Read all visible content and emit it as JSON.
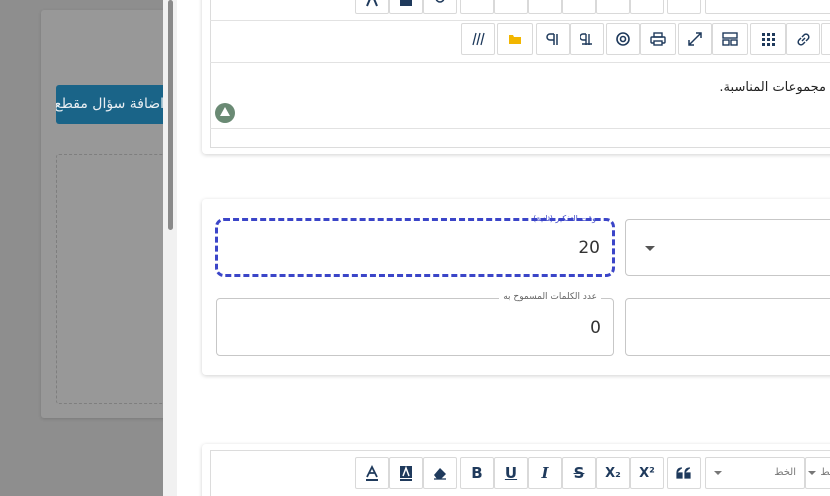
{
  "background": {
    "button_label": "اضافة سؤال مقطع"
  },
  "editor_top": {
    "content_text": "مجموعات المناسبة.",
    "toolbar_row2_icons": [
      "show-blocks-icon",
      "folder-icon",
      "paragraph-rtl-icon",
      "paragraph-ltr-icon",
      "mention-icon",
      "print-icon",
      "fullscreen-icon",
      "template-icon",
      "table-icon",
      "unlink-icon"
    ]
  },
  "form": {
    "time_label": "وقت التفكير (ثانية)",
    "time_value": "20",
    "words_label": "عدد الكلمات المسموح به",
    "words_value": "0"
  },
  "editor_bottom": {
    "font_select_label": "الخط",
    "size_select_label": "خط",
    "superscript_label": "X²",
    "subscript_label": "X₂",
    "bold_label": "B",
    "underline_label": "U",
    "italic_label": "I",
    "strike_label": "S"
  },
  "colors": {
    "focus": "#3b45c8",
    "button_bg": "#1a6488",
    "icon": "#1f3a5c"
  }
}
